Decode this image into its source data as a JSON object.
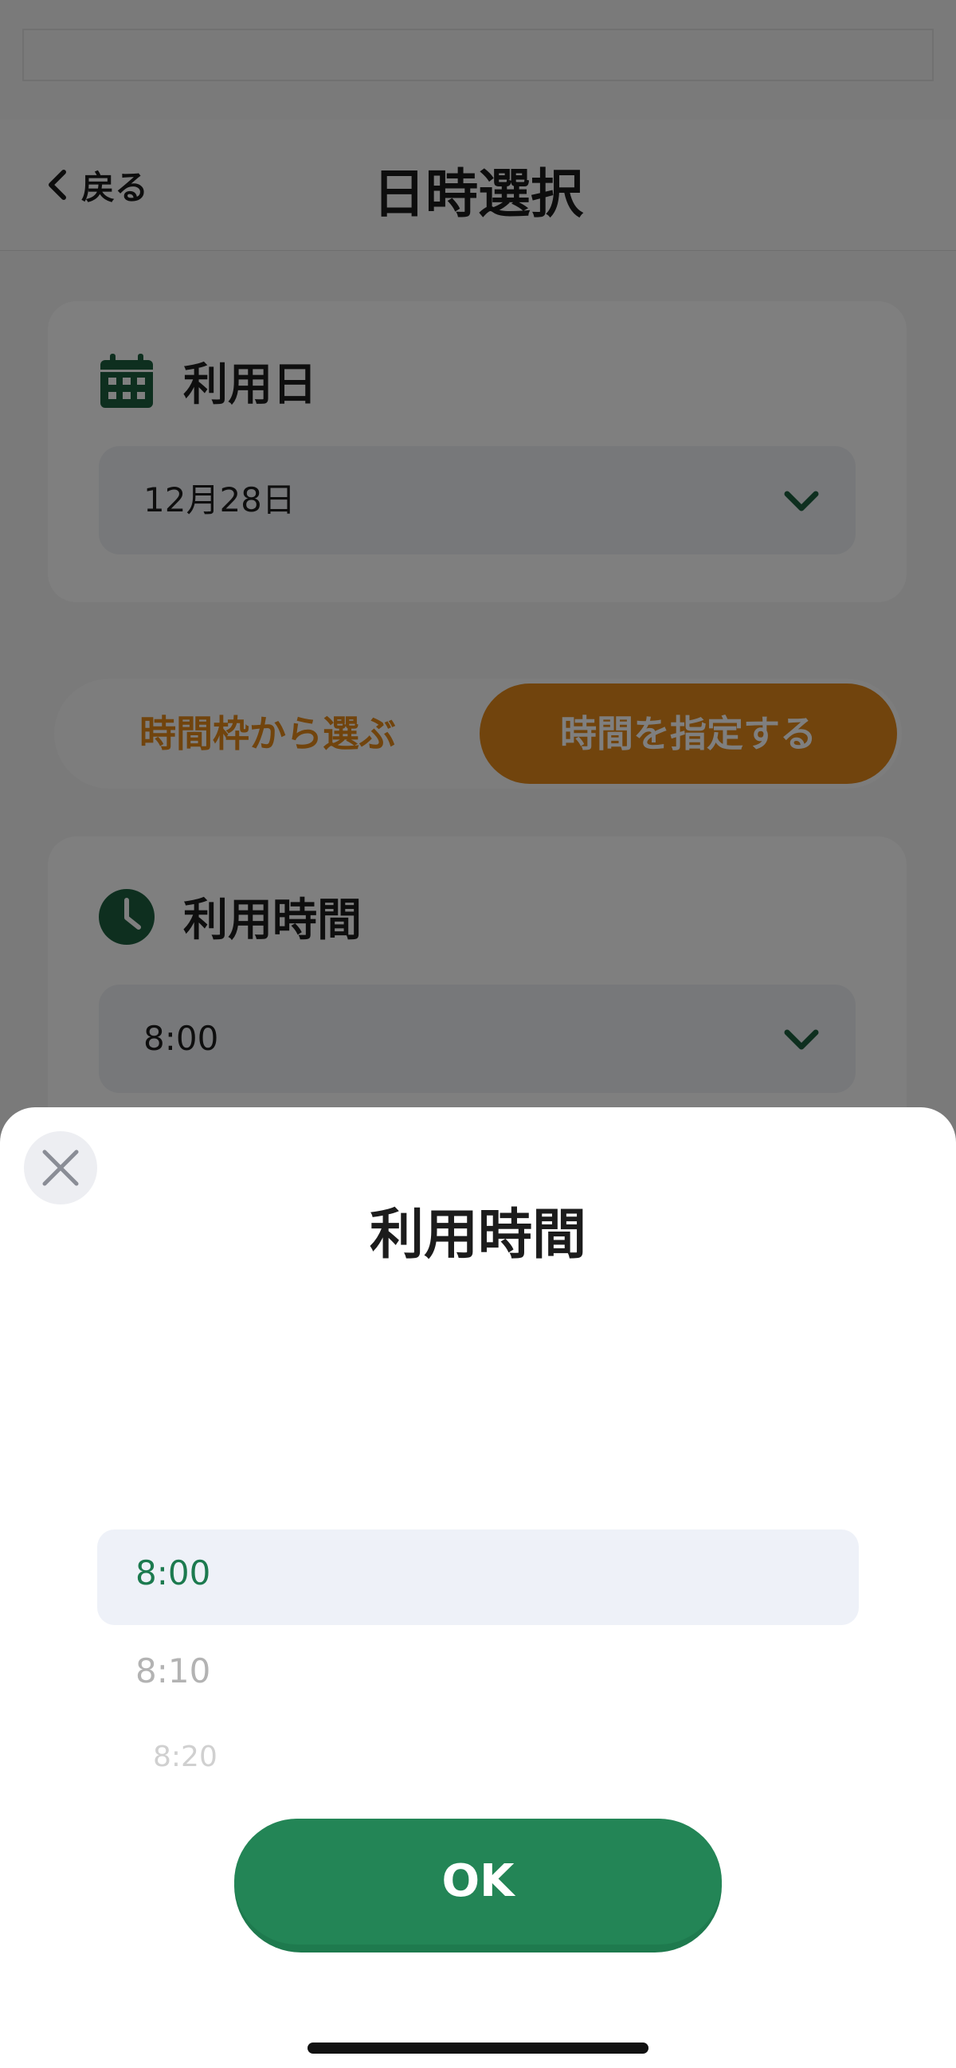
{
  "header": {
    "back_label": "戻る",
    "title": "日時選択"
  },
  "date_card": {
    "label": "利用日",
    "value": "12月28日"
  },
  "segment": {
    "option_slots": "時間枠から選ぶ",
    "option_specify": "時間を指定する",
    "selected": "option_specify"
  },
  "time_card": {
    "label": "利用時間",
    "value": "8:00"
  },
  "sheet": {
    "title": "利用時間",
    "options": [
      "8:00",
      "8:10",
      "8:20"
    ],
    "selected": "8:00",
    "ok_label": "OK"
  },
  "colors": {
    "accent_green": "#238556",
    "accent_orange": "#e2891a",
    "icon_green": "#1c5f3f"
  },
  "icons": {
    "back": "chevron-left-icon",
    "calendar": "calendar-icon",
    "clock": "clock-icon",
    "dropdown": "chevron-down-icon",
    "close": "close-icon"
  }
}
